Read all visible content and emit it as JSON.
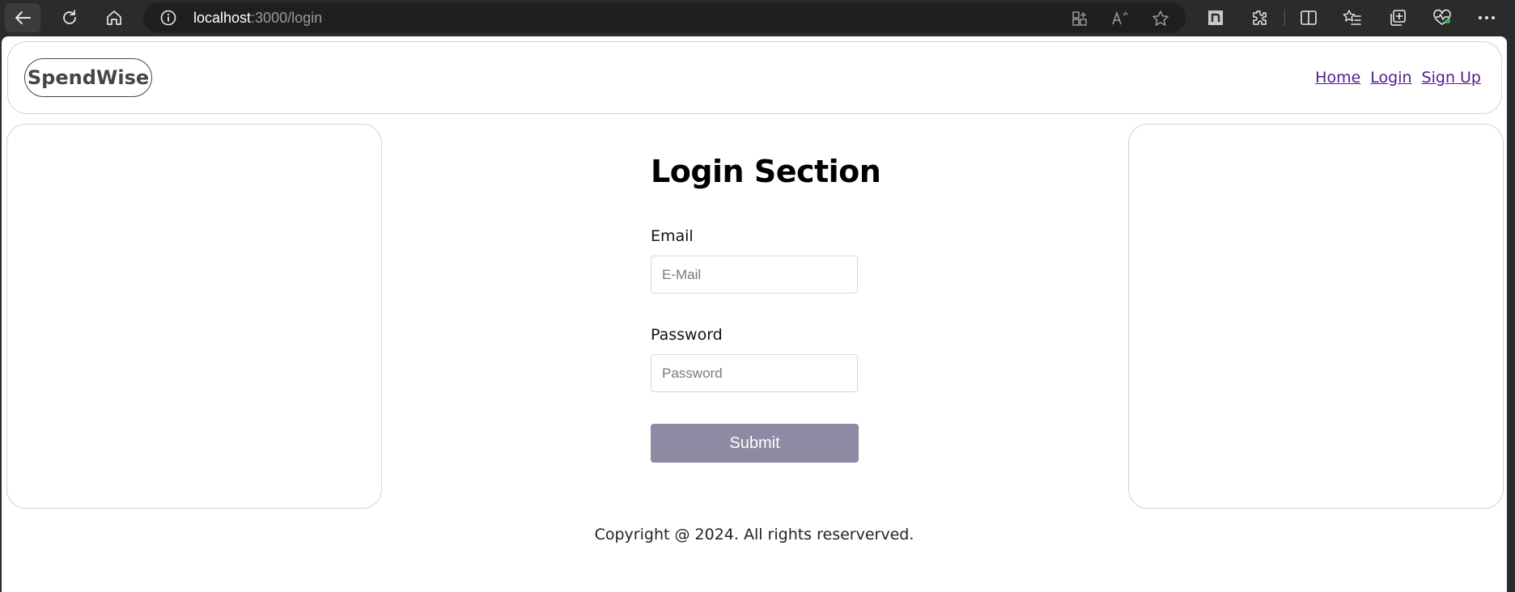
{
  "browser": {
    "url_host": "localhost",
    "url_rest": ":3000/login",
    "icons": [
      "back-icon",
      "reload-icon",
      "home-icon",
      "info-icon",
      "split-screen-icon",
      "read-aloud-icon",
      "favorite-star-icon",
      "extension-n-icon",
      "extensions-icon",
      "split-window-icon",
      "favorites-icon",
      "collections-icon",
      "browser-essentials-icon",
      "more-icon"
    ]
  },
  "header": {
    "logo": "SpendWise",
    "nav": [
      {
        "label": "Home"
      },
      {
        "label": "Login"
      },
      {
        "label": "Sign Up"
      }
    ]
  },
  "login": {
    "title": "Login Section",
    "email_label": "Email",
    "email_placeholder": "E-Mail",
    "password_label": "Password",
    "password_placeholder": "Password",
    "submit_label": "Submit"
  },
  "footer": {
    "text": "Copyright @ 2024. All rights reserverved."
  },
  "colors": {
    "submit_bg": "#8e8aa3",
    "link": "#551a8b",
    "logo_text": "#4a4343"
  }
}
